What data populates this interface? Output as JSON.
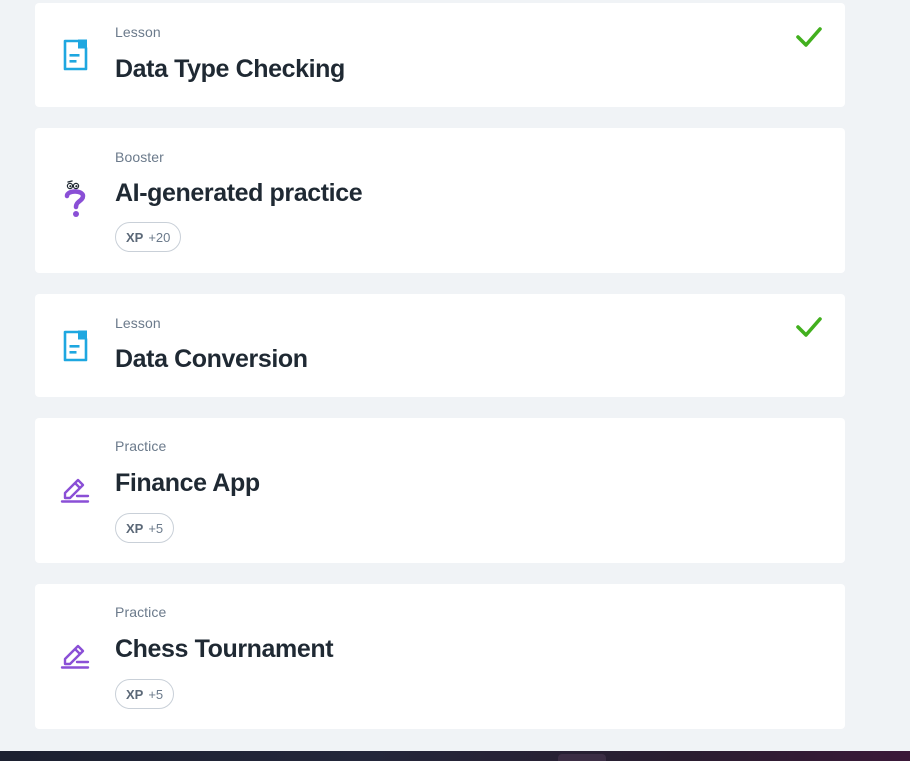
{
  "items": [
    {
      "type": "Lesson",
      "title": "Data Type Checking",
      "icon": "lesson-document-icon",
      "completed": true
    },
    {
      "type": "Booster",
      "title": "AI-generated practice",
      "icon": "question-mark-character-icon",
      "xp_label": "XP",
      "xp_value": "+20",
      "completed": false
    },
    {
      "type": "Lesson",
      "title": "Data Conversion",
      "icon": "lesson-document-icon",
      "completed": true
    },
    {
      "type": "Practice",
      "title": "Finance App",
      "icon": "pencil-edit-icon",
      "xp_label": "XP",
      "xp_value": "+5",
      "completed": false
    },
    {
      "type": "Practice",
      "title": "Chess Tournament",
      "icon": "pencil-edit-icon",
      "xp_label": "XP",
      "xp_value": "+5",
      "completed": false
    }
  ],
  "colors": {
    "lesson_icon": "#1ea7e0",
    "practice_icon": "#8a4fd6",
    "check": "#42b01e",
    "background": "#f0f3f6"
  }
}
